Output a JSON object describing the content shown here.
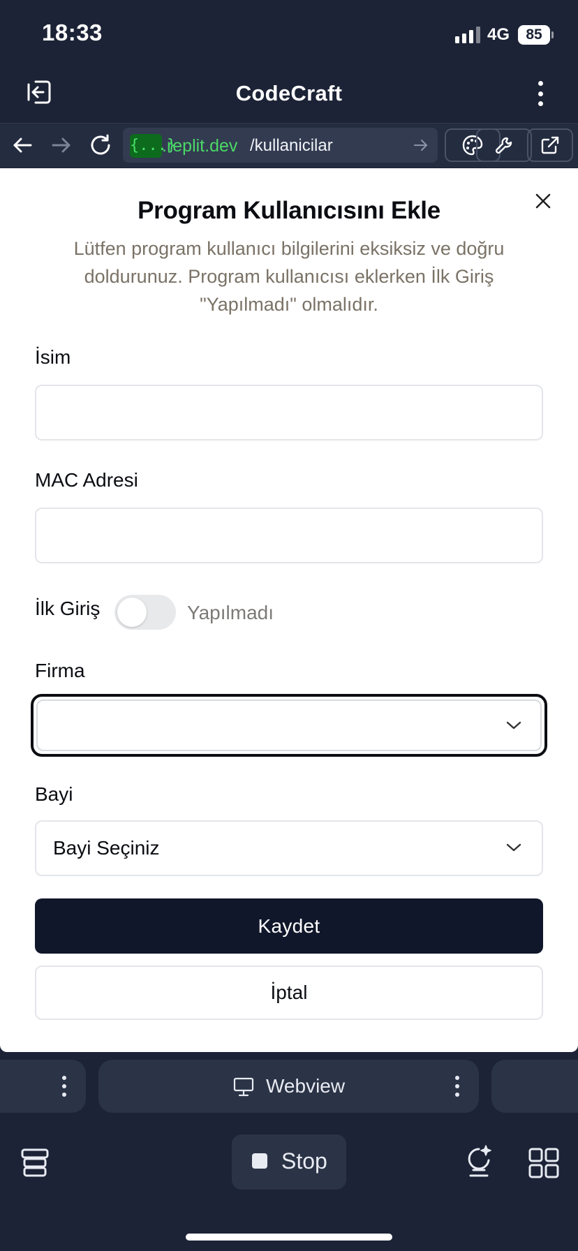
{
  "status_bar": {
    "time": "18:33",
    "network": "4G",
    "battery": "85"
  },
  "header": {
    "title": "CodeCraft"
  },
  "url_bar": {
    "badge": "{...}",
    "domain": ".replit.dev",
    "path": "/kullanicilar"
  },
  "modal": {
    "title": "Program Kullanıcısını Ekle",
    "description": "Lütfen program kullanıcı bilgilerini eksiksiz ve doğru doldurunuz. Program kullanıcısı eklerken İlk Giriş \"Yapılmadı\" olmalıdır.",
    "fields": {
      "name_label": "İsim",
      "name_value": "",
      "mac_label": "MAC Adresi",
      "mac_value": "",
      "first_login_label": "İlk Giriş",
      "first_login_state": "Yapılmadı",
      "first_login_on": false,
      "company_label": "Firma",
      "company_value": "",
      "dealer_label": "Bayi",
      "dealer_value": "Bayi Seçiniz"
    },
    "save_label": "Kaydet",
    "cancel_label": "İptal"
  },
  "bottom_tabs": {
    "active_tab_label": "Webview"
  },
  "bottom_toolbar": {
    "stop_label": "Stop"
  },
  "colors": {
    "app_background": "#1c2336",
    "url_domain": "#4bd866",
    "primary_button": "#11172a",
    "muted_text": "#7a7266"
  },
  "icons": [
    "exit-icon",
    "more-vertical-icon",
    "back-arrow-icon",
    "forward-arrow-icon",
    "reload-icon",
    "go-arrow-icon",
    "palette-icon",
    "wrench-icon",
    "external-link-icon",
    "close-icon",
    "chevron-down-icon",
    "monitor-icon",
    "layers-icon",
    "ai-sparkle-icon",
    "grid-icon"
  ]
}
